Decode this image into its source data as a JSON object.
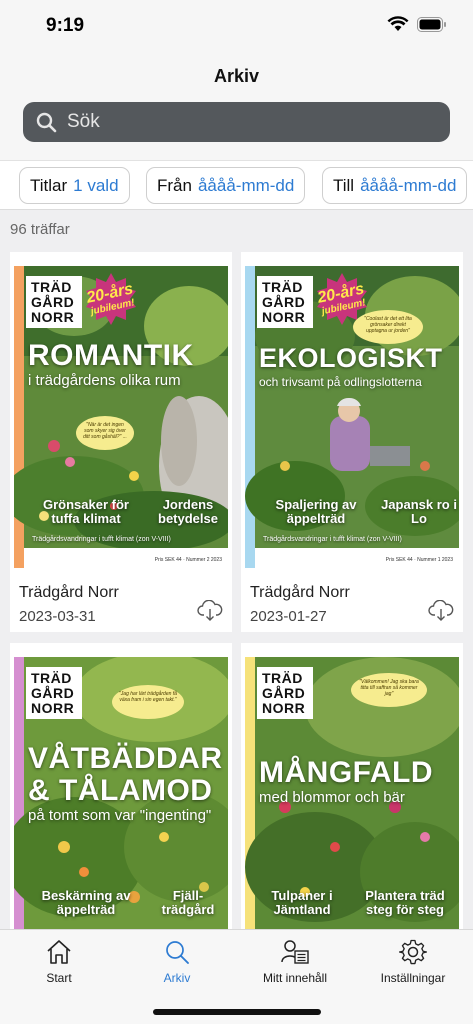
{
  "status": {
    "time": "9:19"
  },
  "header": {
    "title": "Arkiv"
  },
  "search": {
    "placeholder": "Sök"
  },
  "filters": [
    {
      "label": "Titlar",
      "value": "1 vald"
    },
    {
      "label": "Från",
      "value": "åååå-mm-dd"
    },
    {
      "label": "Till",
      "value": "åååå-mm-dd"
    }
  ],
  "results": {
    "count_label": "96 träffar"
  },
  "issues": [
    {
      "title": "Trädgård Norr",
      "date": "2023-03-31",
      "cover": {
        "frame_color": "#f4a160",
        "logo": [
          "TRÄD",
          "GÅRD",
          "NORR"
        ],
        "badge": {
          "top": "20-års",
          "bottom": "jubileum!"
        },
        "headline": "ROMANTIK",
        "subheadline": "i trädgårdens olika rum",
        "quote": "\"När är det ingen som skyer sig över ditt som gåshäl?\" ...",
        "teaser_left": "Grönsaker för tuffa klimat",
        "teaser_right": "Jordens betydelse",
        "strip": "Trädgårdsvandringar i tufft klimat (zon V-VIII)",
        "price": "Pris SEK 44 · Nummer 2 2023"
      }
    },
    {
      "title": "Trädgård Norr",
      "date": "2023-01-27",
      "cover": {
        "frame_color": "#a8d8f0",
        "logo": [
          "TRÄD",
          "GÅRD",
          "NORR"
        ],
        "badge": {
          "top": "20-års",
          "bottom": "jubileum!"
        },
        "headline": "EKOLOGISKT",
        "subheadline": "och trivsamt på odlingslotterna",
        "quote": "\"Coolast är det ett lita grönsaker direkt upptagna ur jorden\"",
        "teaser_left": "Spaljering av äppelträd",
        "teaser_right": "Japansk ro i Lo",
        "strip": "Trädgårdsvandringar i tufft klimat (zon V-VIII)",
        "price": "Pris SEK 44 · Nummer 1 2023"
      }
    },
    {
      "title": "",
      "date": "",
      "cover": {
        "frame_color": "#d58fd0",
        "logo": [
          "TRÄD",
          "GÅRD",
          "NORR"
        ],
        "headline": "VÅTBÄDDAR & TÅLAMOD",
        "subheadline": "på tomt som var \"ingenting\"",
        "quote": "\"Jag har lärt trädgården få växa fram i sin egen takt.\"",
        "teaser_left": "Beskärning av äppelträd",
        "teaser_right": "Fjäll-trädgård"
      }
    },
    {
      "title": "",
      "date": "",
      "cover": {
        "frame_color": "#f6e27a",
        "logo": [
          "TRÄD",
          "GÅRD",
          "NORR"
        ],
        "headline": "MÅNGFALD",
        "subheadline": "med blommor och bär",
        "quote": "\"Välkommen! Jag ska bara titta till saffran så kommer jag\"",
        "teaser_left": "Tulpaner i Jämtland",
        "teaser_right": "Plantera träd steg för steg"
      }
    }
  ],
  "tabbar": [
    {
      "label": "Start",
      "icon": "home-icon"
    },
    {
      "label": "Arkiv",
      "icon": "search-icon",
      "active": true
    },
    {
      "label": "Mitt innehåll",
      "icon": "profile-newspaper-icon"
    },
    {
      "label": "Inställningar",
      "icon": "gear-icon"
    }
  ],
  "colors": {
    "accent": "#2d7bd2",
    "searchbar": "#54585c"
  }
}
